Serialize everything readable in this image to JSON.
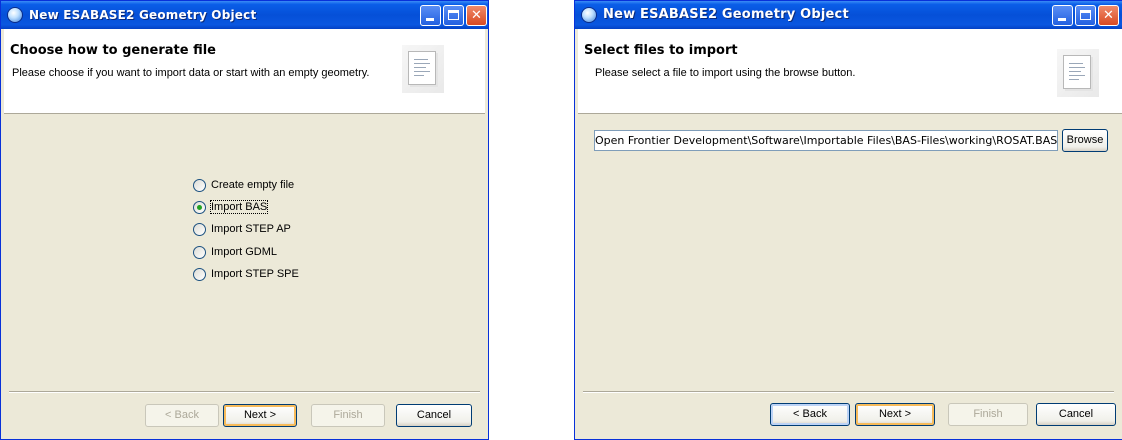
{
  "left_dialog": {
    "title": "New ESABASE2 Geometry Object",
    "heading": "Choose how to generate file",
    "description": "Please choose if you want to import data or start with an empty geometry.",
    "options": [
      {
        "label": "Create empty file",
        "selected": false
      },
      {
        "label": "Import BAS",
        "selected": true
      },
      {
        "label": "Import STEP AP",
        "selected": false
      },
      {
        "label": "Import GDML",
        "selected": false
      },
      {
        "label": "Import STEP SPE",
        "selected": false
      }
    ],
    "buttons": {
      "back": "< Back",
      "next": "Next >",
      "finish": "Finish",
      "cancel": "Cancel"
    }
  },
  "right_dialog": {
    "title": "New ESABASE2 Geometry Object",
    "heading": "Select files to import",
    "description": "Please select a file to import using the browse button.",
    "file_path": "Open Frontier Development\\Software\\Importable Files\\BAS-Files\\working\\ROSAT.BAS",
    "browse_label": "Browse",
    "buttons": {
      "back": "< Back",
      "next": "Next >",
      "finish": "Finish",
      "cancel": "Cancel"
    }
  },
  "colors": {
    "titlebar": "#0550d8",
    "dialog_bg": "#ece9d8",
    "radio_selected_dot": "#21a121",
    "close_button": "#d94a22"
  },
  "icons": [
    "app-icon",
    "minimize-icon",
    "maximize-icon",
    "close-icon",
    "document-icon"
  ]
}
